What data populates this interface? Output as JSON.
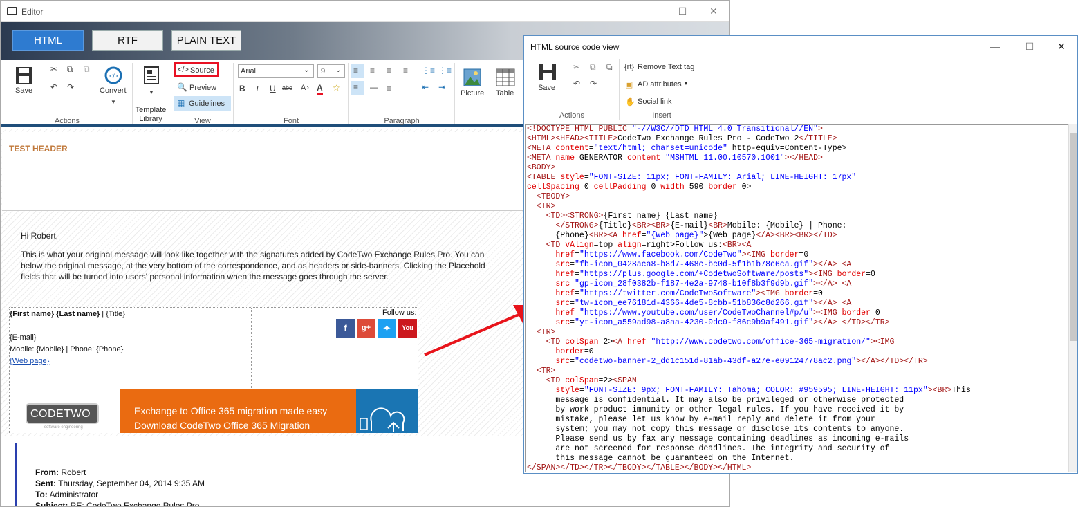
{
  "editor": {
    "title": "Editor",
    "modes": [
      "HTML",
      "RTF",
      "PLAIN TEXT"
    ],
    "ribbon": {
      "save": "Save",
      "convert": "Convert",
      "template_library": "Template Library",
      "source": "Source",
      "preview": "Preview",
      "guidelines": "Guidelines",
      "font_name": "Arial",
      "font_size": "9",
      "picture": "Picture",
      "table": "Table",
      "groups": {
        "actions": "Actions",
        "view": "View",
        "font": "Font",
        "paragraph": "Paragraph"
      }
    },
    "header_text": "TEST HEADER",
    "message": {
      "greeting": "Hi Robert,",
      "line1": "This is what your original message will look like together with the signatures added by CodeTwo Exchange Rules Pro. You can",
      "line2": "below the original message, at the very bottom of the correspondence, and as headers or side-banners. Clicking the Placehold",
      "line3": "fields that will be turned into users' personal information when the message goes through the server."
    },
    "signature": {
      "name_line_bold": "{First name} {Last name}",
      "name_line_rest": " | {Title}",
      "email": "{E-mail}",
      "phones": "Mobile: {Mobile} | Phone: {Phone}",
      "web": "{Web page}",
      "follow": "Follow us:",
      "banner_logo": "CODETWO",
      "banner_logo_sub": "software engineering",
      "banner_line1": "Exchange to Office 365 migration made easy",
      "banner_line2": "Download CodeTwo Office 365 Migration"
    },
    "quote": {
      "from_label": "From:",
      "from": " Robert",
      "sent_label": "Sent:",
      "sent": " Thursday, September 04, 2014 9:35 AM",
      "to_label": "To:",
      "to": " Administrator",
      "subject_label": "Subject:",
      "subject": " RE: CodeTwo Exchange Rules Pro"
    }
  },
  "source_window": {
    "title": "HTML source code view",
    "save": "Save",
    "remove_text_tag": "Remove Text tag",
    "ad_attributes": "AD attributes",
    "social_link": "Social link",
    "groups": {
      "actions": "Actions",
      "insert": "Insert"
    }
  },
  "colors": {
    "accent": "#2e7bd0",
    "banner_orange": "#ea6b11",
    "banner_blue": "#1a75b3",
    "highlight": "#e81123",
    "arrow": "#e8141b"
  }
}
